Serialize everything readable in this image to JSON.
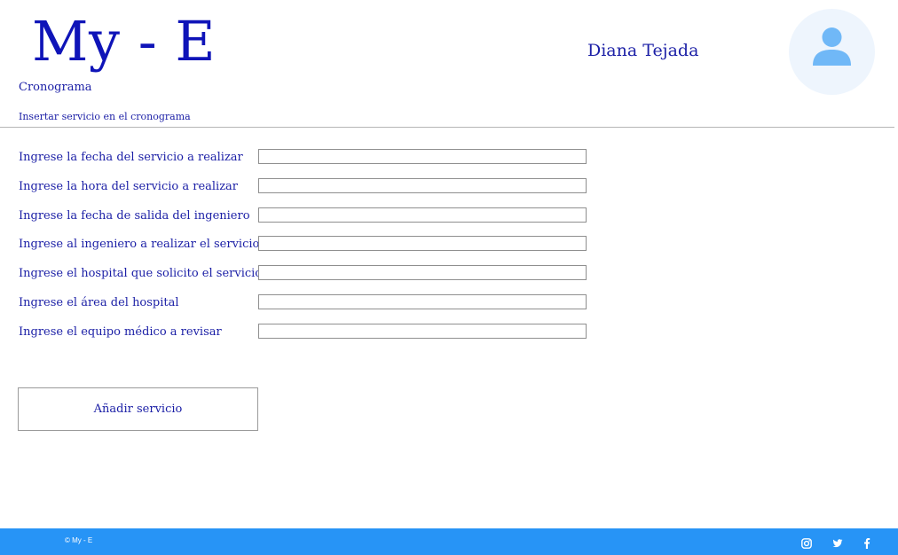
{
  "header": {
    "logo": "My - E",
    "nav_link": "Cronograma",
    "user_name": "Diana Tejada",
    "avatar_icon": "user-icon"
  },
  "page": {
    "subtitle": "Insertar servicio en el cronograma"
  },
  "form": {
    "fields": [
      {
        "label": "Ingrese la fecha del servicio a realizar",
        "value": "",
        "placeholder": ""
      },
      {
        "label": "Ingrese la hora del servicio a realizar",
        "value": "",
        "placeholder": ""
      },
      {
        "label": "Ingrese la fecha de salida del ingeniero",
        "value": "",
        "placeholder": ""
      },
      {
        "label": "Ingrese al ingeniero a realizar el servicio",
        "value": "",
        "placeholder": ""
      },
      {
        "label": "Ingrese el hospital que solicito el servicio",
        "value": "",
        "placeholder": ""
      },
      {
        "label": "Ingrese el área del hospital",
        "value": "",
        "placeholder": ""
      },
      {
        "label": "Ingrese el equipo médico a revisar",
        "value": "",
        "placeholder": ""
      }
    ],
    "submit_label": "Añadir servicio"
  },
  "footer": {
    "copyright": "© My - E",
    "social_icons": [
      "instagram-icon",
      "twitter-icon",
      "facebook-icon"
    ]
  },
  "colors": {
    "brand": "#0f14b8",
    "text": "#1b1fa6",
    "footer": "#2794f6",
    "avatar_bg": "#eef5fd",
    "avatar_icon": "#70b8f7"
  }
}
